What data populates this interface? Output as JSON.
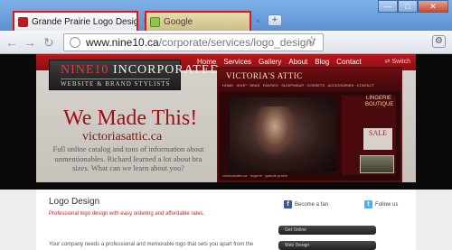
{
  "browser": {
    "tabs": [
      {
        "label": "Grande Prairie Logo Design",
        "active": true
      },
      {
        "label": "Google",
        "active": false
      }
    ],
    "close_glyph": "×",
    "new_tab_glyph": "+",
    "window_buttons": {
      "minimize": "—",
      "maximize": "□",
      "close": "✕"
    },
    "nav": {
      "back": "←",
      "forward": "→",
      "reload": "↻"
    },
    "address": {
      "host": "www.nine10.ca",
      "path": "/corporate/services/logo_design/"
    },
    "bookmark_glyph": "☆",
    "menu_glyph": "⚙"
  },
  "site": {
    "logo": {
      "number": "NINE10",
      "name": "INCORPORATED",
      "tagline": "WEBSITE & BRAND STYLISTS"
    },
    "nav": [
      "Home",
      "Services",
      "Gallery",
      "About",
      "Blog",
      "Contact"
    ],
    "switch_label": "Switch",
    "hero": {
      "headline": "We Made This!",
      "url": "victoriasattic.ca",
      "blurb": "Full online catalog and tons of information about unmentionables. Richard learned a lot about bra sizes. What can we learn about you?"
    },
    "showcase": {
      "brand": "VICTORIA'S ATTIC",
      "nav_text": "HOME · SHOP · BRAS · PANTIES · SLEEPWEAR · CORSETS · ACCESSORIES · CONTACT",
      "side_text": "LINGERIE BOUTIQUE",
      "sale": "SALE",
      "footer_text": "victoriasattic.ca · lingerie · grande prairie"
    },
    "content": {
      "title": "Logo Design",
      "lead": "Professional logo design with easy ordering and affordable rates.",
      "body": "Your company needs a professional and memorable logo that sets you apart from the"
    },
    "social": [
      {
        "label": "Become a fan",
        "icon": "facebook-icon",
        "glyph": "f"
      },
      {
        "label": "Follow us",
        "icon": "twitter-icon",
        "glyph": "t"
      }
    ],
    "services": [
      "Get Online",
      "Web Design"
    ]
  },
  "colors": {
    "brand_red": "#a01015",
    "nav_red": "#b7181d",
    "tab_highlight": "#e0151b"
  }
}
